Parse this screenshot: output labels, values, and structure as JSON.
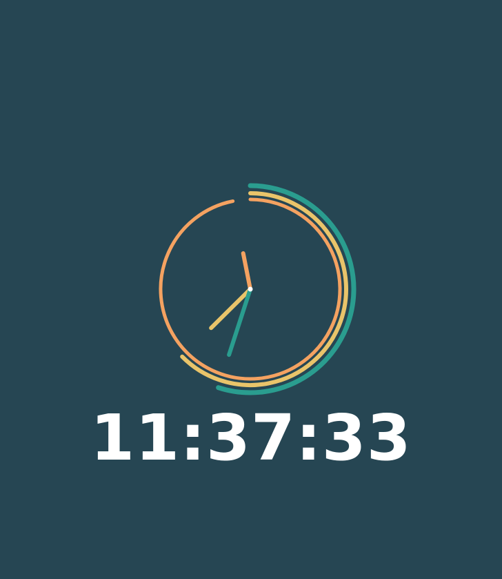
{
  "clock": {
    "time_text": "11:37:33",
    "hours": 11,
    "minutes": 37,
    "seconds": 33,
    "colors": {
      "background": "#264653",
      "hour": "#f4a261",
      "minute": "#e9c46a",
      "second": "#2a9d8f",
      "center_dot": "#ffffff",
      "time_text": "#ffffff"
    }
  }
}
